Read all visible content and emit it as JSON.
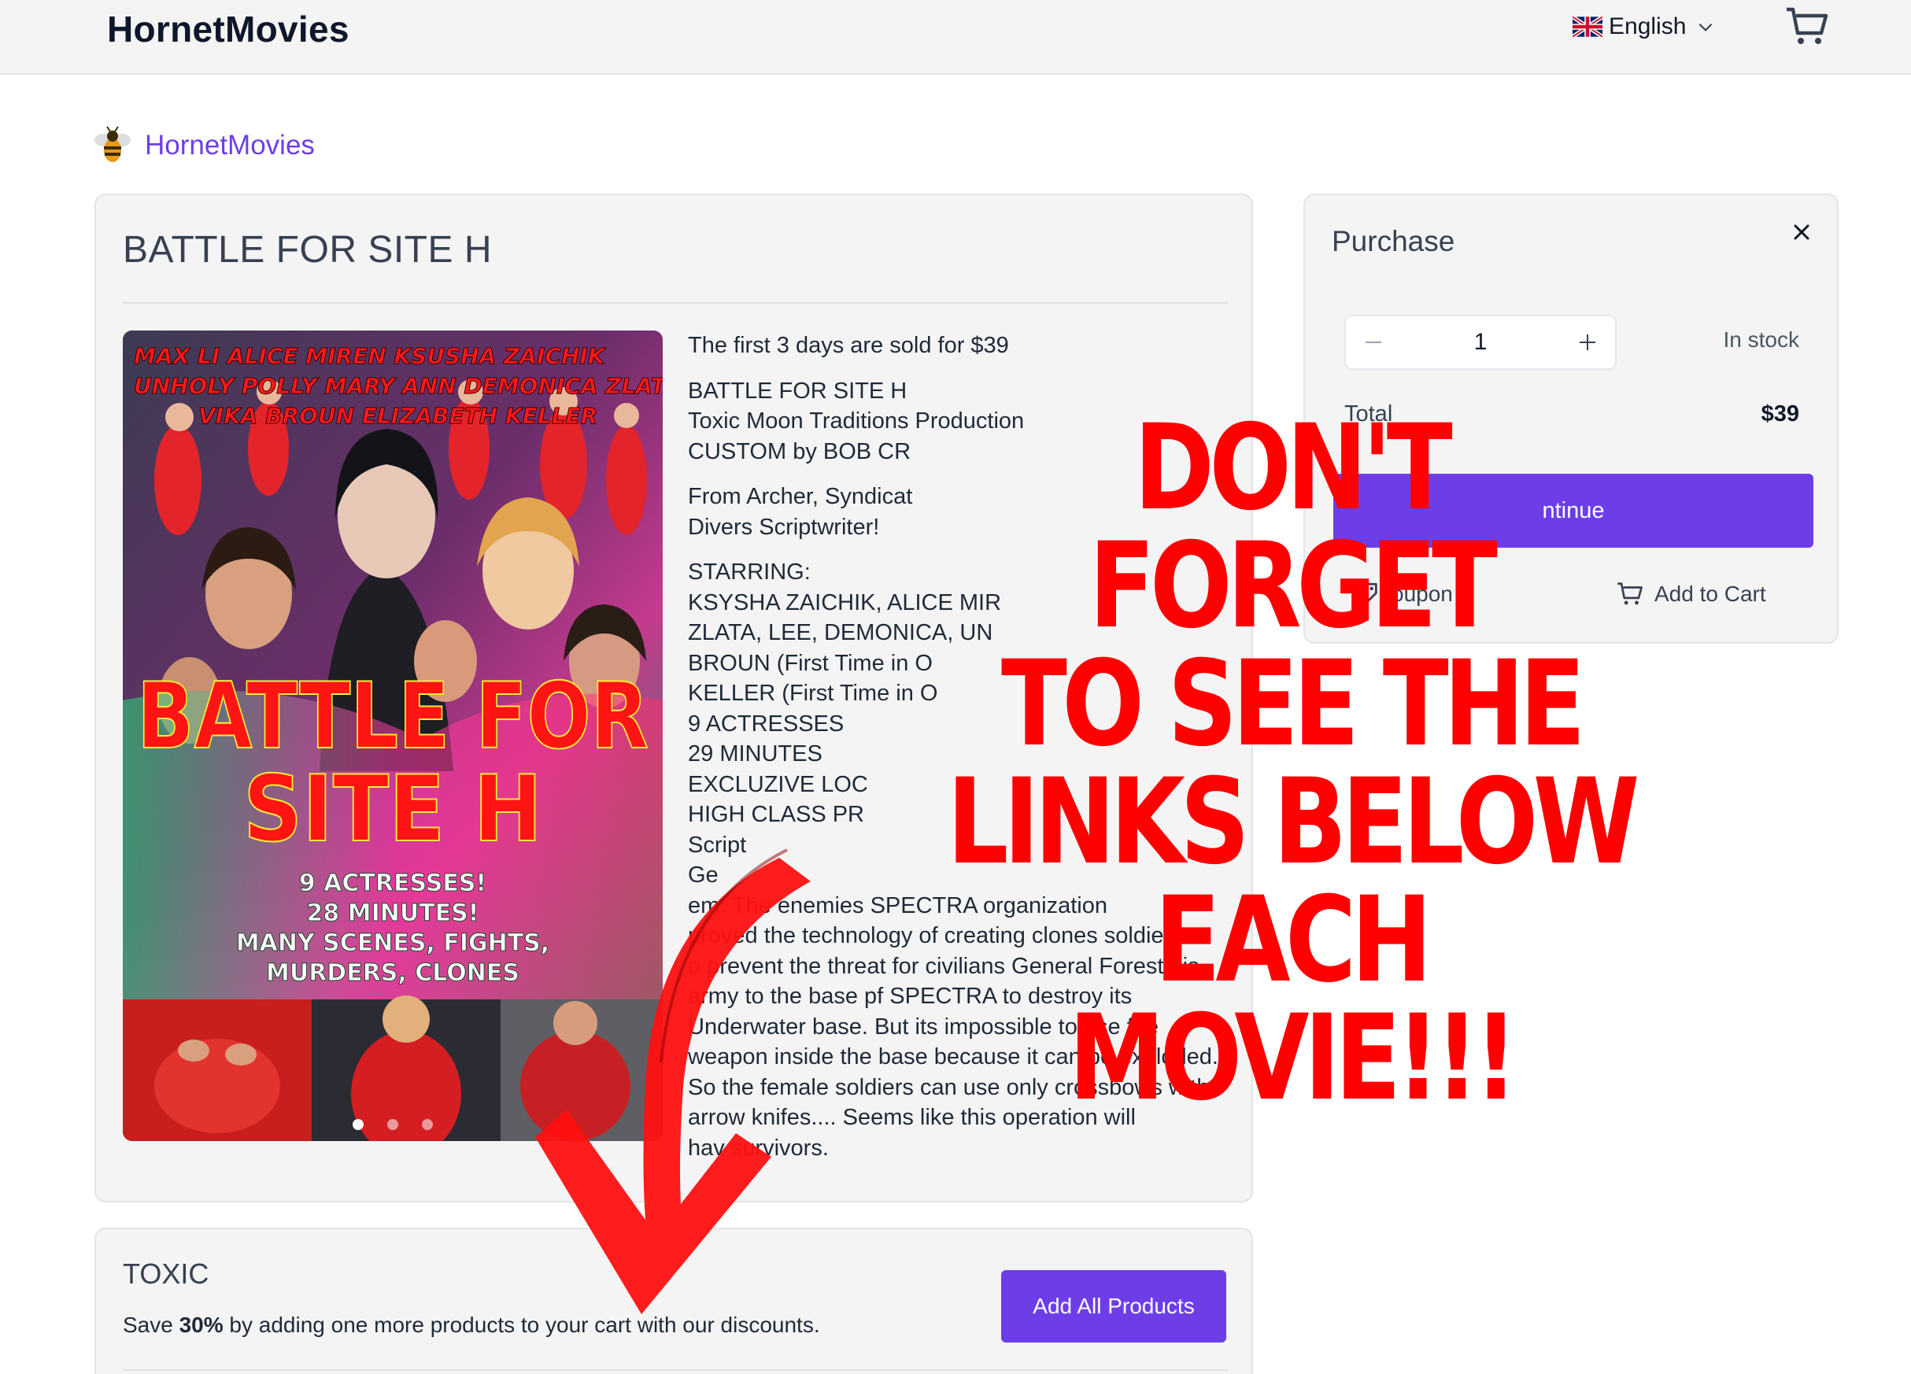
{
  "header": {
    "brand": "HornetMovies",
    "language": "English"
  },
  "breadcrumb": {
    "label": "HornetMovies"
  },
  "product": {
    "title": "BATTLE FOR SITE H",
    "poster": {
      "cast_line_1": "MAX LI  ALICE MIREN KSUSHA ZAICHIK",
      "cast_line_2": "UNHOLY POLLY MARY ANN DEMONICA ZLATA",
      "cast_line_3": "VIKA BROUN ELIZABETH KELLER",
      "title_line_1": "BATTLE  FOR",
      "title_line_2": "SITE  H",
      "tag_1": "9 ACTRESSES!",
      "tag_2": "28 MINUTES!",
      "tag_3": "MANY SCENES, FIGHTS,",
      "tag_4": "MURDERS, CLONES"
    },
    "description": {
      "price_note": "The first 3 days are sold for $39",
      "title_line": "BATTLE FOR SITE H",
      "production": "Toxic Moon Traditions Production",
      "custom": "CUSTOM by BOB CR",
      "writer_1": "From Archer, Syndicat",
      "writer_2": "Divers Scriptwriter!",
      "starring_label": "STARRING:",
      "starring_1": "KSYSHA ZAICHIK, ALICE MIR",
      "starring_2": "ZLATA, LEE, DEMONICA, UN",
      "starring_3": "BROUN (First Time in O",
      "starring_4": "KELLER (First Time in O",
      "actresses": "9 ACTRESSES",
      "minutes": "29 MINUTES",
      "location": "EXCLUZIVE LOC",
      "class": "HIGH CLASS PR",
      "script_label": "Script",
      "plot_1": "Ge",
      "plot_2": "em. The enemies SPECTRA organization",
      "plot_3": "proved the technology of creating clones soldiers.",
      "plot_4": "o prevent the threat for civilians General Forest his",
      "plot_5": "army to the base pf SPECTRA to destroy its",
      "plot_6": "Underwater base. But its impossible to use fire",
      "plot_7": "weapon inside the base because it can be exploded.",
      "plot_8": "So the female soldiers can use only crossbows with",
      "plot_9": "arrow    knifes.... Seems like this operation will",
      "plot_10": "hav    survivors."
    }
  },
  "purchase": {
    "title": "Purchase",
    "quantity": "1",
    "stock": "In stock",
    "total_label": "Total",
    "total_value": "$39",
    "continue_label": "ntinue",
    "coupon_label": "oupon",
    "add_to_cart_label": "Add to Cart"
  },
  "bundle": {
    "title": "TOXIC",
    "text_prefix": "Save ",
    "discount": "30%",
    "text_suffix": " by adding one more products to your cart with our discounts.",
    "button_label": "Add All Products"
  },
  "promo": {
    "line_1": "DON'T FORGET",
    "line_2": "TO SEE THE",
    "line_3": "LINKS BELOW",
    "line_4": "EACH MOVIE!!!"
  },
  "colors": {
    "accent": "#6d3ee8",
    "promo": "#ff0000",
    "card_bg": "#f4f4f5"
  },
  "icons": [
    "uk-flag-icon",
    "chevron-down-icon",
    "cart-icon",
    "bee-icon",
    "close-icon",
    "minus-icon",
    "plus-icon",
    "tag-icon",
    "red-arrow-icon"
  ]
}
